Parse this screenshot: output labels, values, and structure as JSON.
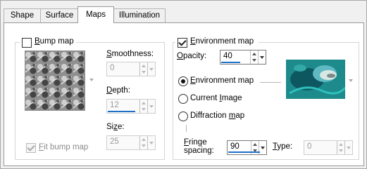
{
  "tabs": [
    {
      "label": "Shape",
      "active": false
    },
    {
      "label": "Surface",
      "active": false
    },
    {
      "label": "Maps",
      "active": true
    },
    {
      "label": "Illumination",
      "active": false
    }
  ],
  "bump": {
    "checkbox_label": "Bump map",
    "checked": false,
    "smoothness_label": "Smoothness:",
    "smoothness_value": "0",
    "depth_label": "Depth:",
    "depth_value": "12",
    "size_label": "Size:",
    "size_value": "25",
    "fit_label": "Fit bump map",
    "fit_checked": true
  },
  "environment": {
    "checkbox_label": "Environment map",
    "checked": true,
    "opacity_label": "Opacity:",
    "opacity_value": "40",
    "options": [
      {
        "label": "Environment map",
        "selected": true
      },
      {
        "label": "Current Image",
        "selected": false
      },
      {
        "label": "Diffraction map",
        "selected": false
      }
    ],
    "fringe_label": "Fringe\nspacing:",
    "fringe_value": "90",
    "type_label": "Type:",
    "type_value": "0"
  },
  "colors": {
    "accent": "#1e70c8",
    "teal": "#1e8e8a"
  }
}
